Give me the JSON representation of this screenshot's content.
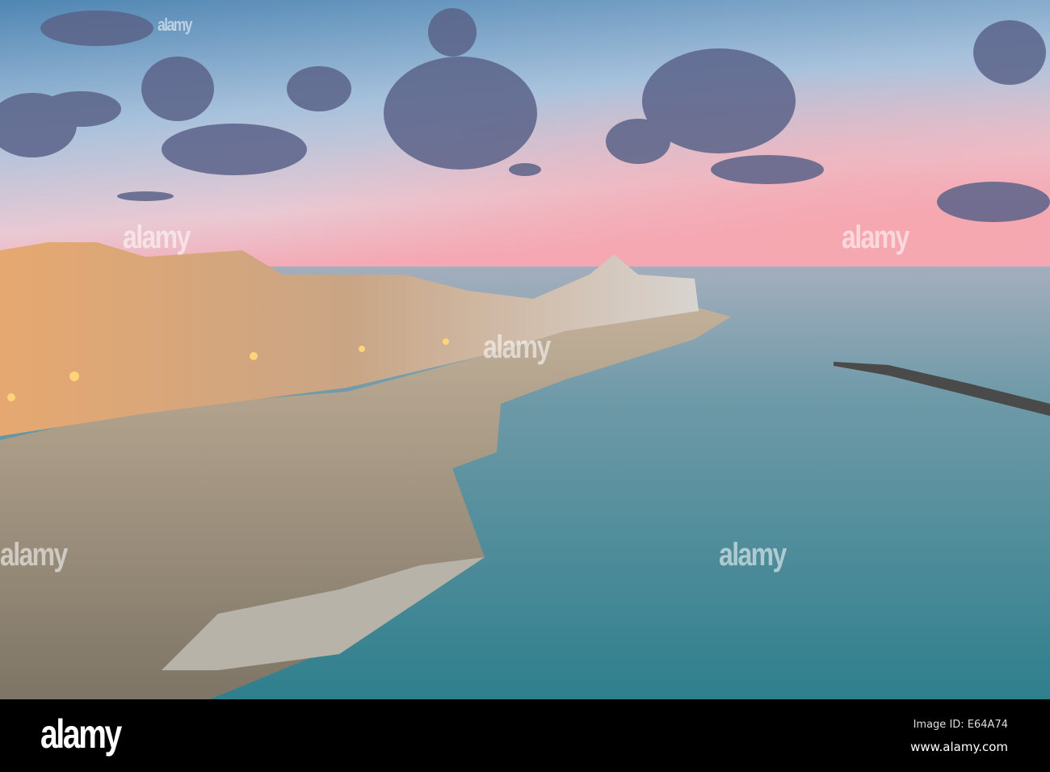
{
  "photo": {
    "description_label": "alamy",
    "colors": {
      "sky_top": "#5f93bb",
      "sky_mid": "#b9cbe0",
      "sky_pink": "#f2b2bd",
      "sea_far": "#8aa3b4",
      "sea_near": "#3f8795",
      "cliff": "#b7a78f",
      "town": "#e0a868",
      "cloud": "#5e6488"
    }
  },
  "watermark": {
    "text": "alamy"
  },
  "footer": {
    "logo": "alamy",
    "image_id": "Image ID: E64A74",
    "url": "www.alamy.com"
  }
}
